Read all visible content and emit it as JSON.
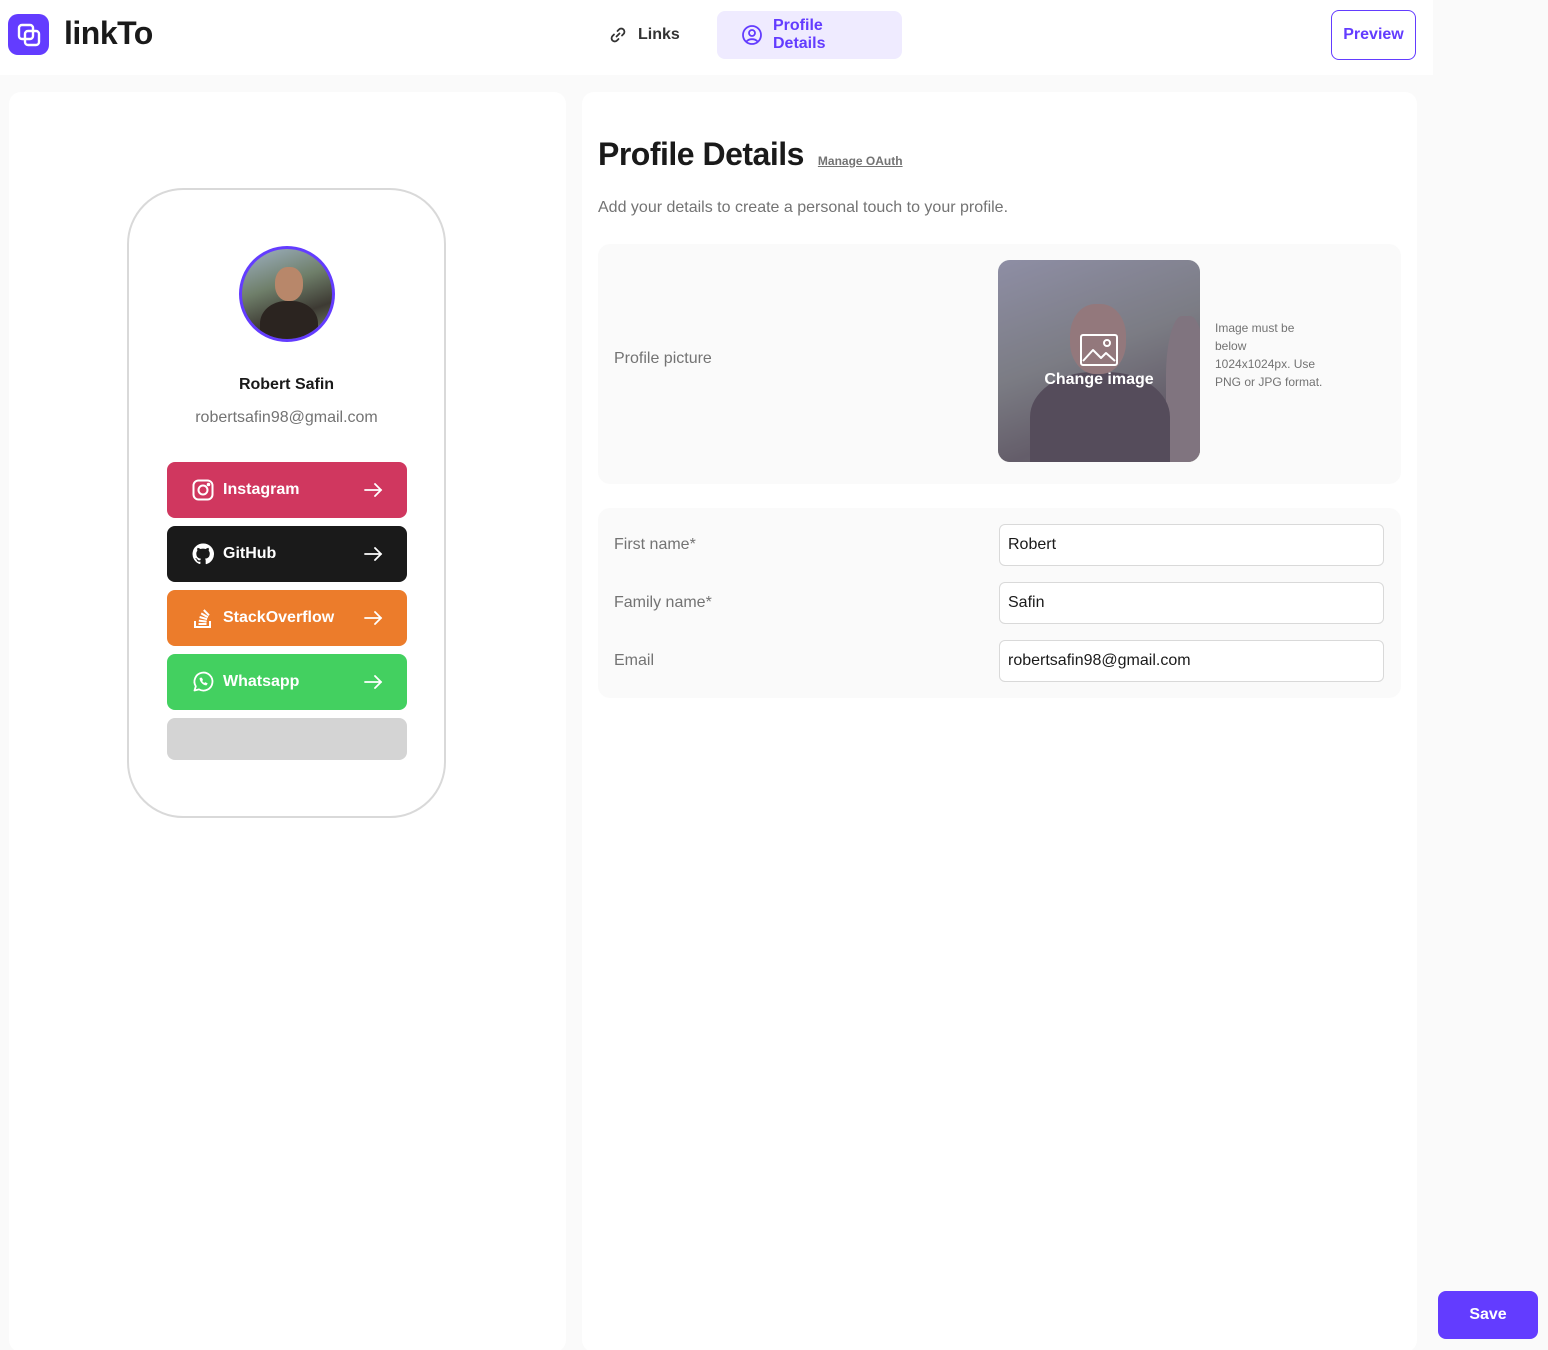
{
  "app": {
    "name": "linkTo"
  },
  "nav": {
    "tabs": [
      {
        "label": "Links",
        "icon": "link-icon",
        "active": false
      },
      {
        "label": "Profile Details",
        "icon": "user-circle-icon",
        "active": true
      }
    ],
    "preview_label": "Preview"
  },
  "colors": {
    "accent": "#633cff",
    "accent_light": "#efebff"
  },
  "preview": {
    "name": "Robert Safin",
    "email": "robertsafin98@gmail.com",
    "links": [
      {
        "platform": "Instagram",
        "icon": "instagram-icon",
        "color": "#d0375f"
      },
      {
        "platform": "GitHub",
        "icon": "github-icon",
        "color": "#1a1a1a"
      },
      {
        "platform": "StackOverflow",
        "icon": "stackoverflow-icon",
        "color": "#ec7c2b"
      },
      {
        "platform": "Whatsapp",
        "icon": "whatsapp-icon",
        "color": "#43d060"
      }
    ]
  },
  "profile": {
    "title": "Profile Details",
    "oauth_link": "Manage OAuth",
    "subtitle": "Add your details to create a personal touch to your profile.",
    "picture": {
      "label": "Profile picture",
      "change_label": "Change image",
      "note": "Image must be below 1024x1024px. Use PNG or JPG format."
    },
    "fields": [
      {
        "label": "First name*",
        "value": "Robert"
      },
      {
        "label": "Family name*",
        "value": "Safin"
      },
      {
        "label": "Email",
        "value": "robertsafin98@gmail.com"
      }
    ]
  },
  "save_label": "Save"
}
